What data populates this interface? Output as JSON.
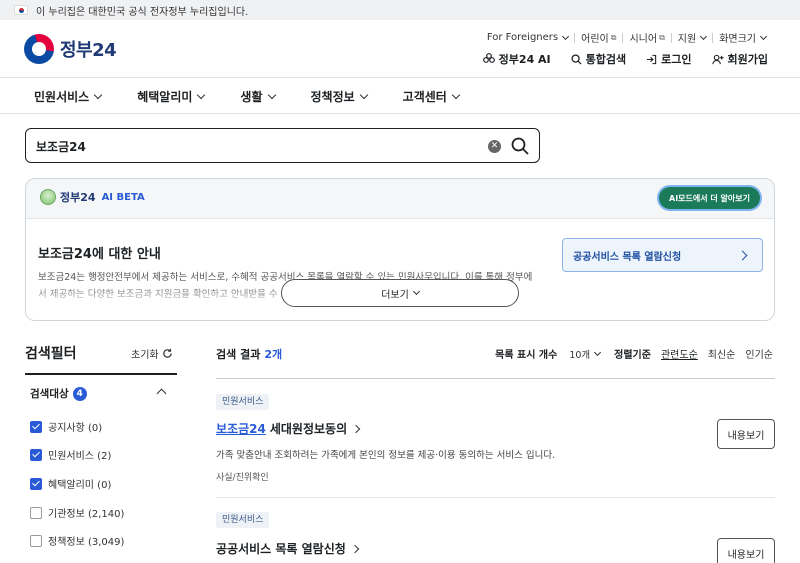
{
  "gov_banner": {
    "text": "이 누리집은 대한민국 공식 전자정부 누리집입니다."
  },
  "header": {
    "logo_text": "정부24",
    "util_nav": [
      "For Foreigners",
      "어린이",
      "시니어",
      "지원",
      "화면크기"
    ],
    "actions": [
      "정부24 AI",
      "통합검색",
      "로그인",
      "회원가입"
    ]
  },
  "gnb": [
    "민원서비스",
    "혜택알리미",
    "생활",
    "정책정보",
    "고객센터"
  ],
  "search": {
    "value": "보조금24"
  },
  "ai_panel": {
    "brand": "정부24",
    "beta": "AI BETA",
    "mode_button": "AI모드에서 더 알아보기",
    "title": "보조금24에 대한 안내",
    "body": "보조금24는 행정안전부에서 제공하는 서비스로, 수혜적 공공서비스 목록을 열람할 수 있는 민원사무입니다. 이를 통해 정부에서 제공하는 다양한 보조금과 지원금을 확인하고 안내받을 수 있습니다.",
    "more_button": "더보기",
    "apply_button": "공공서비스 목록 열람신청"
  },
  "filter": {
    "title": "검색필터",
    "reset": "초기화",
    "group_label": "검색대상",
    "group_count": "4",
    "options": [
      {
        "label": "공지사항 (0)",
        "checked": true
      },
      {
        "label": "민원서비스 (2)",
        "checked": true
      },
      {
        "label": "혜택알리미 (0)",
        "checked": true
      },
      {
        "label": "기관정보 (2,140)",
        "checked": false
      },
      {
        "label": "정책정보 (3,049)",
        "checked": false
      }
    ]
  },
  "results": {
    "label": "검색 결과",
    "count": "2개",
    "page_size_label": "목록 표시 개수",
    "page_size": "10개",
    "sort_label": "정렬기준",
    "sort_options": [
      "관련도순",
      "최신순",
      "인기순"
    ],
    "items": [
      {
        "tag": "민원서비스",
        "title_highlight": "보조금24",
        "title_rest": "세대원정보동의",
        "desc": "가족 맞춤안내 조회하려는 가족에게 본인의 정보를 제공·이용 동의하는 서비스 입니다.",
        "meta": "사실/진위확인",
        "button": "내용보기"
      },
      {
        "tag": "민원서비스",
        "title_highlight": "",
        "title_rest": "공공서비스 목록 열람신청",
        "desc": "",
        "meta": "",
        "button": "내용보기"
      }
    ]
  }
}
